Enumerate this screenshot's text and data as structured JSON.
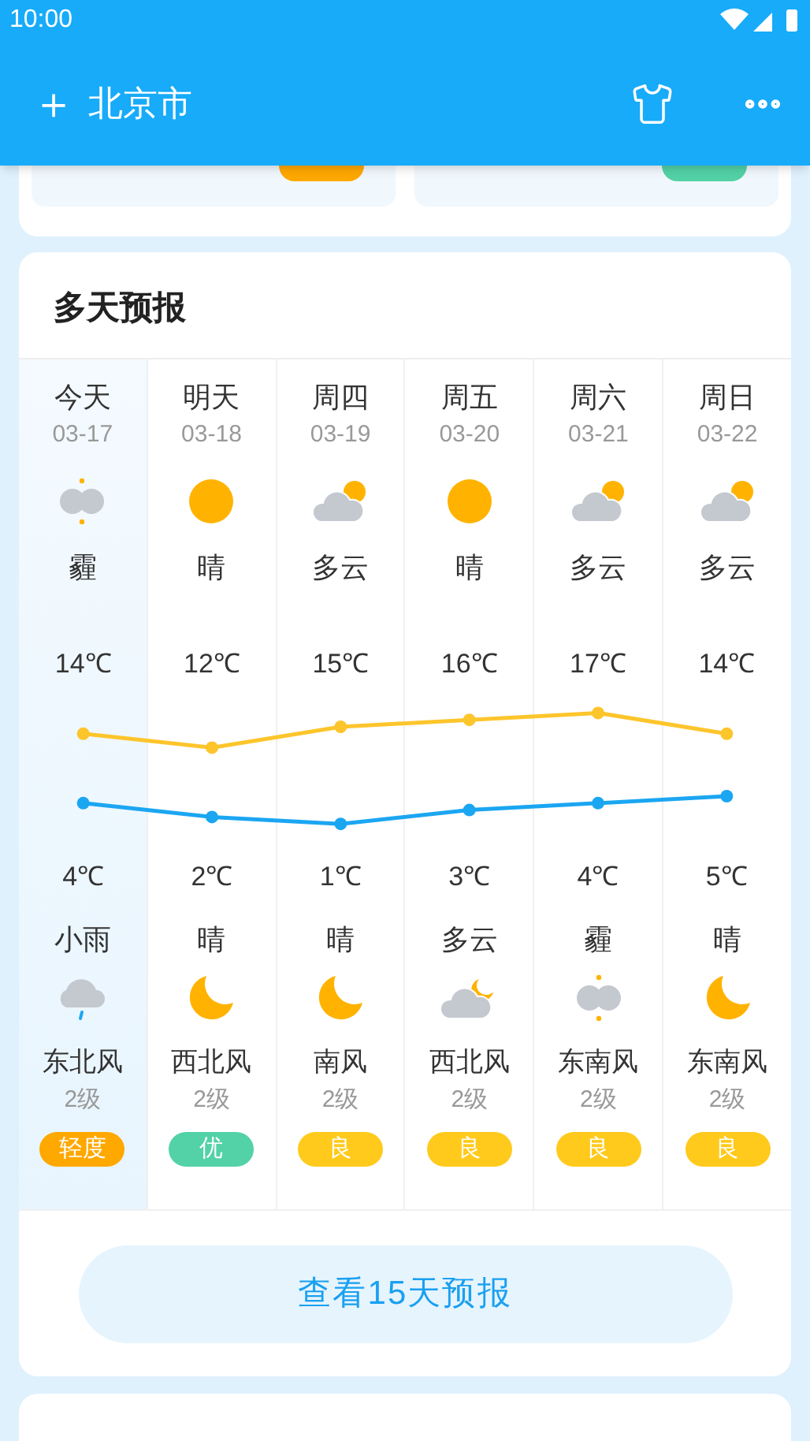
{
  "status_bar": {
    "time": "10:00"
  },
  "header": {
    "add": "＋",
    "city": "北京市"
  },
  "today_cards": [
    {
      "color": "#ffa800"
    },
    {
      "color": "#52d2a6"
    }
  ],
  "forecast": {
    "title": "多天预报",
    "days": [
      {
        "day": "今天",
        "date": "03-17",
        "day_icon": {
          "kind": "haze"
        },
        "day_weather": "霾",
        "night_weather": "小雨",
        "night_icon": {
          "kind": "rain"
        },
        "wind": "东北风",
        "wind_level": "2级",
        "aqi": "轻度",
        "color": "#ffa800",
        "selected": true
      },
      {
        "day": "明天",
        "date": "03-18",
        "day_icon": {
          "kind": "sun"
        },
        "day_weather": "晴",
        "night_weather": "晴",
        "night_icon": {
          "kind": "moon"
        },
        "wind": "西北风",
        "wind_level": "2级",
        "aqi": "优",
        "color": "#52d2a6",
        "selected": false
      },
      {
        "day": "周四",
        "date": "03-19",
        "day_icon": {
          "kind": "cloud_sun"
        },
        "day_weather": "多云",
        "night_weather": "晴",
        "night_icon": {
          "kind": "moon"
        },
        "wind": "南风",
        "wind_level": "2级",
        "aqi": "良",
        "color": "#ffca1c",
        "selected": false
      },
      {
        "day": "周五",
        "date": "03-20",
        "day_icon": {
          "kind": "sun"
        },
        "day_weather": "晴",
        "night_weather": "多云",
        "night_icon": {
          "kind": "cloud_moon"
        },
        "wind": "西北风",
        "wind_level": "2级",
        "aqi": "良",
        "color": "#ffca1c",
        "selected": false
      },
      {
        "day": "周六",
        "date": "03-21",
        "day_icon": {
          "kind": "cloud_sun"
        },
        "day_weather": "多云",
        "night_weather": "霾",
        "night_icon": {
          "kind": "haze"
        },
        "wind": "东南风",
        "wind_level": "2级",
        "aqi": "良",
        "color": "#ffca1c",
        "selected": false
      },
      {
        "day": "周日",
        "date": "03-22",
        "day_icon": {
          "kind": "cloud_sun"
        },
        "day_weather": "多云",
        "night_weather": "晴",
        "night_icon": {
          "kind": "moon"
        },
        "wind": "东南风",
        "wind_level": "2级",
        "aqi": "良",
        "color": "#ffca1c",
        "selected": false
      }
    ],
    "chart_data": {
      "type": "line",
      "series": [
        {
          "color": "#fdc52c",
          "marker": "circle",
          "values": [
            14,
            12,
            15,
            16,
            17,
            14
          ],
          "value_labels": [
            "14℃",
            "12℃",
            "15℃",
            "16℃",
            "17℃",
            "14℃"
          ]
        },
        {
          "color": "#1ba6f2",
          "marker": "circle",
          "values": [
            4,
            2,
            1,
            3,
            4,
            5
          ],
          "value_labels": [
            "4℃",
            "2℃",
            "1℃",
            "3℃",
            "4℃",
            "5℃"
          ]
        }
      ]
    },
    "more_button": "查看15天预报"
  }
}
